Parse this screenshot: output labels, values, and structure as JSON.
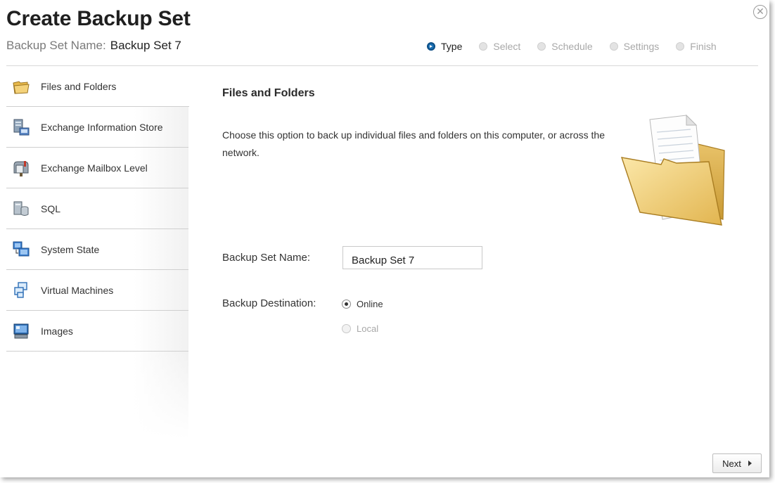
{
  "header": {
    "title": "Create Backup Set",
    "subtitle_label": "Backup Set Name:",
    "subtitle_value": "Backup Set 7"
  },
  "steps": [
    {
      "label": "Type",
      "active": true
    },
    {
      "label": "Select",
      "active": false
    },
    {
      "label": "Schedule",
      "active": false
    },
    {
      "label": "Settings",
      "active": false
    },
    {
      "label": "Finish",
      "active": false
    }
  ],
  "sidebar": {
    "items": [
      {
        "label": "Files and Folders",
        "icon": "folder-icon",
        "selected": true
      },
      {
        "label": "Exchange Information Store",
        "icon": "exchange-store-icon"
      },
      {
        "label": "Exchange Mailbox Level",
        "icon": "mailbox-icon"
      },
      {
        "label": "SQL",
        "icon": "sql-database-icon"
      },
      {
        "label": "System State",
        "icon": "system-state-icon"
      },
      {
        "label": "Virtual Machines",
        "icon": "virtual-machines-icon"
      },
      {
        "label": "Images",
        "icon": "disk-image-icon"
      }
    ]
  },
  "main": {
    "title": "Files and Folders",
    "description": "Choose this option to back up individual files and folders on this computer, or across the network.",
    "name_label": "Backup Set Name:",
    "name_value": "Backup Set 7",
    "destination_label": "Backup Destination:",
    "destination_options": [
      {
        "label": "Online",
        "checked": true,
        "enabled": true
      },
      {
        "label": "Local",
        "checked": false,
        "enabled": false
      }
    ]
  },
  "footer": {
    "next_label": "Next"
  },
  "colors": {
    "accent": "#1a6fb3",
    "divider": "#cfcfcf"
  }
}
